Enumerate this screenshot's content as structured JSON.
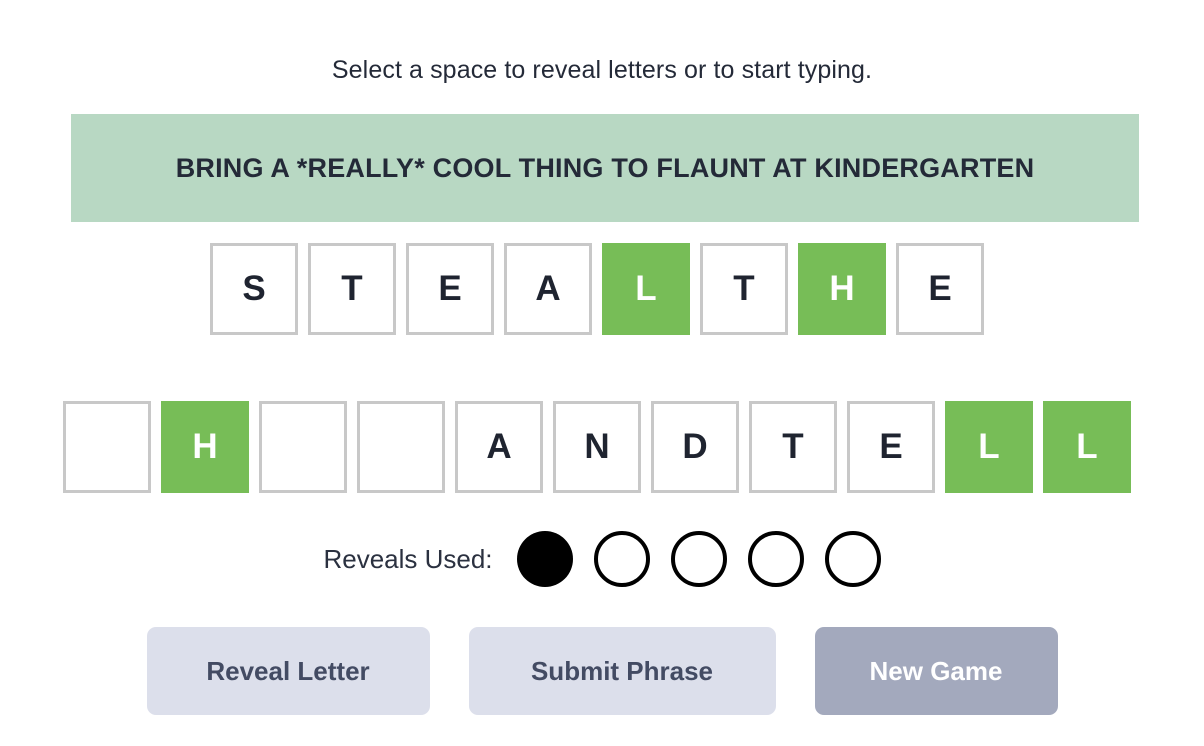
{
  "instruction": "Select a space to reveal letters or to start typing.",
  "hint": {
    "text": "BRING A *REALLY* COOL THING TO FLAUNT AT KINDERGARTEN",
    "background_color": "#b8d8c3"
  },
  "colors": {
    "revealed_tile": "#77bd57",
    "tile_border": "#c8c8c8",
    "text_dark": "#1f2430",
    "button_secondary_bg": "#dcdfeb",
    "button_secondary_text": "#434b63",
    "button_primary_bg": "#a3a9bd",
    "button_primary_text": "#ffffff",
    "dot_filled": "#000000"
  },
  "puzzle": {
    "rows": [
      {
        "row_index": 0,
        "tiles": [
          {
            "letter": "S",
            "revealed": false,
            "word_end": false
          },
          {
            "letter": "T",
            "revealed": false,
            "word_end": false
          },
          {
            "letter": "E",
            "revealed": false,
            "word_end": false
          },
          {
            "letter": "A",
            "revealed": false,
            "word_end": false
          },
          {
            "letter": "L",
            "revealed": true,
            "word_end": true
          },
          {
            "letter": "T",
            "revealed": false,
            "word_end": false
          },
          {
            "letter": "H",
            "revealed": true,
            "word_end": false
          },
          {
            "letter": "E",
            "revealed": false,
            "word_end": false
          }
        ]
      },
      {
        "row_index": 1,
        "tiles": [
          {
            "letter": "",
            "revealed": false,
            "word_end": false
          },
          {
            "letter": "H",
            "revealed": true,
            "word_end": false
          },
          {
            "letter": "",
            "revealed": false,
            "word_end": false
          },
          {
            "letter": "",
            "revealed": false,
            "word_end": true
          },
          {
            "letter": "A",
            "revealed": false,
            "word_end": false
          },
          {
            "letter": "N",
            "revealed": false,
            "word_end": false
          },
          {
            "letter": "D",
            "revealed": false,
            "word_end": true
          },
          {
            "letter": "T",
            "revealed": false,
            "word_end": false
          },
          {
            "letter": "E",
            "revealed": false,
            "word_end": false
          },
          {
            "letter": "L",
            "revealed": true,
            "word_end": false
          },
          {
            "letter": "L",
            "revealed": true,
            "word_end": false
          }
        ]
      }
    ]
  },
  "reveals": {
    "label": "Reveals Used:",
    "used": 1,
    "total": 5,
    "dots": [
      {
        "used": true
      },
      {
        "used": false
      },
      {
        "used": false
      },
      {
        "used": false
      },
      {
        "used": false
      }
    ]
  },
  "buttons": {
    "reveal_letter": "Reveal Letter",
    "submit_phrase": "Submit Phrase",
    "new_game": "New Game"
  }
}
